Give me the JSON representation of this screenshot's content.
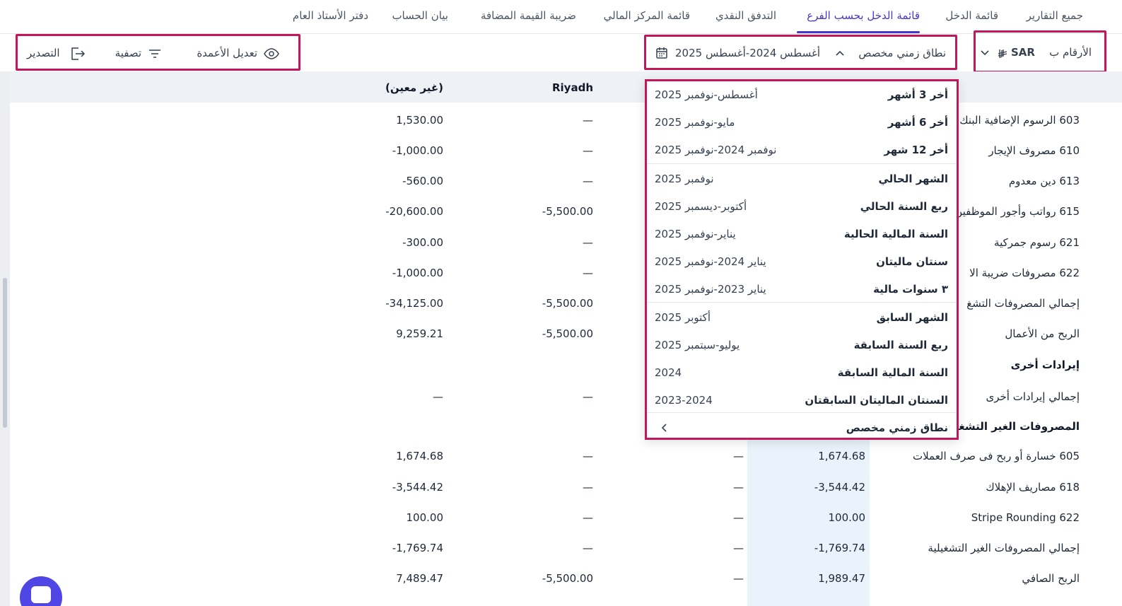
{
  "tabs": [
    {
      "label": "جميع التقارير"
    },
    {
      "label": "قائمة الدخل"
    },
    {
      "label": "قائمة الدخل بحسب الفرع"
    },
    {
      "label": "التدفق النقدي"
    },
    {
      "label": "قائمة المركز المالي"
    },
    {
      "label": "ضريبة القيمة المضافة"
    },
    {
      "label": "بيان الحساب"
    },
    {
      "label": "دفتر الأستاذ العام"
    }
  ],
  "active_tab": "قائمة الدخل بحسب الفرع",
  "toolbar": {
    "numbers_in_label": "الأرقام ب",
    "currency": "SAR",
    "date_range_type": "نطاق زمني مخصص",
    "date_range_value": "أغسطس 2024-أغسطس 2025",
    "edit_columns": "تعديل الأعمدة",
    "filter": "تصفية",
    "export": "التصدير"
  },
  "table": {
    "headers": {
      "riyadh": "Riyadh",
      "unassigned": "(غير معين)"
    },
    "rows": [
      {
        "label": "603 الرسوم الإضافية البنك",
        "riyadh": "—",
        "unassigned": "1,530.00",
        "bold": false
      },
      {
        "label": "610 مصروف الإيجار",
        "riyadh": "—",
        "unassigned": "-1,000.00",
        "bold": false
      },
      {
        "label": "613 دين معدوم",
        "riyadh": "—",
        "unassigned": "-560.00",
        "bold": false
      },
      {
        "label": "615 رواتب وأجور الموظفين",
        "riyadh": "-5,500.00",
        "unassigned": "-20,600.00",
        "bold": false
      },
      {
        "label": "621 رسوم جمركية",
        "riyadh": "—",
        "unassigned": "-300.00",
        "bold": false
      },
      {
        "label": "622 مصروفات ضريبة الا",
        "riyadh": "—",
        "unassigned": "-1,000.00",
        "bold": false
      },
      {
        "label": "إجمالي المصروفات التشغ",
        "riyadh": "-5,500.00",
        "unassigned": "-34,125.00",
        "bold": false
      },
      {
        "label": "الربح من الأعمال",
        "riyadh": "-5,500.00",
        "unassigned": "9,259.21",
        "bold": false
      },
      {
        "label": "إيرادات أخرى",
        "riyadh": "",
        "unassigned": "",
        "bold": true
      },
      {
        "label": "إجمالي إيرادات أخرى",
        "riyadh": "—",
        "unassigned": "—",
        "bold": false
      },
      {
        "label": "المصروفات الغير التشغيلية",
        "riyadh": "",
        "unassigned": "",
        "bold": true
      },
      {
        "label": "605 خسارة أو ربح فى صرف العملات",
        "total": "1,674.68",
        "col3": "—",
        "riyadh": "—",
        "unassigned": "1,674.68",
        "bold": false
      },
      {
        "label": "618 مصاريف الإهلاك",
        "total": "-3,544.42",
        "col3": "—",
        "riyadh": "—",
        "unassigned": "-3,544.42",
        "bold": false
      },
      {
        "label": "Stripe Rounding 622",
        "total": "100.00",
        "col3": "—",
        "riyadh": "—",
        "unassigned": "100.00",
        "bold": false
      },
      {
        "label": "إجمالي المصروفات الغير التشغيلية",
        "total": "-1,769.74",
        "col3": "—",
        "riyadh": "—",
        "unassigned": "-1,769.74",
        "bold": false
      },
      {
        "label": "الربح الصافي",
        "total": "1,989.47",
        "col3": "—",
        "riyadh": "-5,500.00",
        "unassigned": "7,489.47",
        "bold": false
      }
    ]
  },
  "date_dropdown": {
    "options": [
      {
        "label": "أخر 3 أشهر",
        "range": "أغسطس-نوفمبر 2025"
      },
      {
        "label": "أخر 6 أشهر",
        "range": "مايو-نوفمبر 2025"
      },
      {
        "label": "أخر 12 شهر",
        "range": "نوفمبر 2024-نوفمبر 2025"
      },
      {
        "label": "الشهر الحالي",
        "range": "نوفمبر 2025"
      },
      {
        "label": "ربع السنة الحالي",
        "range": "أكتوبر-ديسمبر 2025"
      },
      {
        "label": "السنة المالية الحالية",
        "range": "يناير-نوفمبر 2025"
      },
      {
        "label": "سنتان ماليتان",
        "range": "يناير 2024-نوفمبر 2025"
      },
      {
        "label": "٣ سنوات مالية",
        "range": "يناير 2023-نوفمبر 2025"
      },
      {
        "label": "الشهر السابق",
        "range": "أكتوبر 2025"
      },
      {
        "label": "ربع السنة السابقة",
        "range": "يوليو-سبتمبر 2025"
      },
      {
        "label": "السنة المالية السابقة",
        "range": "2024"
      },
      {
        "label": "السنتان الماليتان السابقتان",
        "range": "2023-2024"
      }
    ],
    "custom_label": "نطاق زمني مخصص"
  },
  "colors": {
    "accent": "#4338ca",
    "highlight_border": "#c2185b",
    "header_bg": "#eef1f6"
  }
}
